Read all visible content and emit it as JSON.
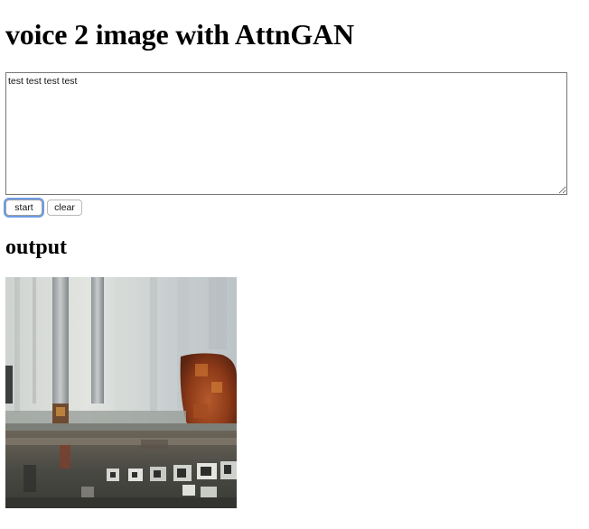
{
  "page": {
    "title": "voice 2 image with AttnGAN"
  },
  "input": {
    "text_value": "test test test test"
  },
  "buttons": {
    "start_label": "start",
    "clear_label": "clear"
  },
  "output": {
    "heading": "output",
    "image_description_icon": "generated-image"
  },
  "colors": {
    "focus_ring": "#6e9be6",
    "textarea_border": "#767676"
  }
}
